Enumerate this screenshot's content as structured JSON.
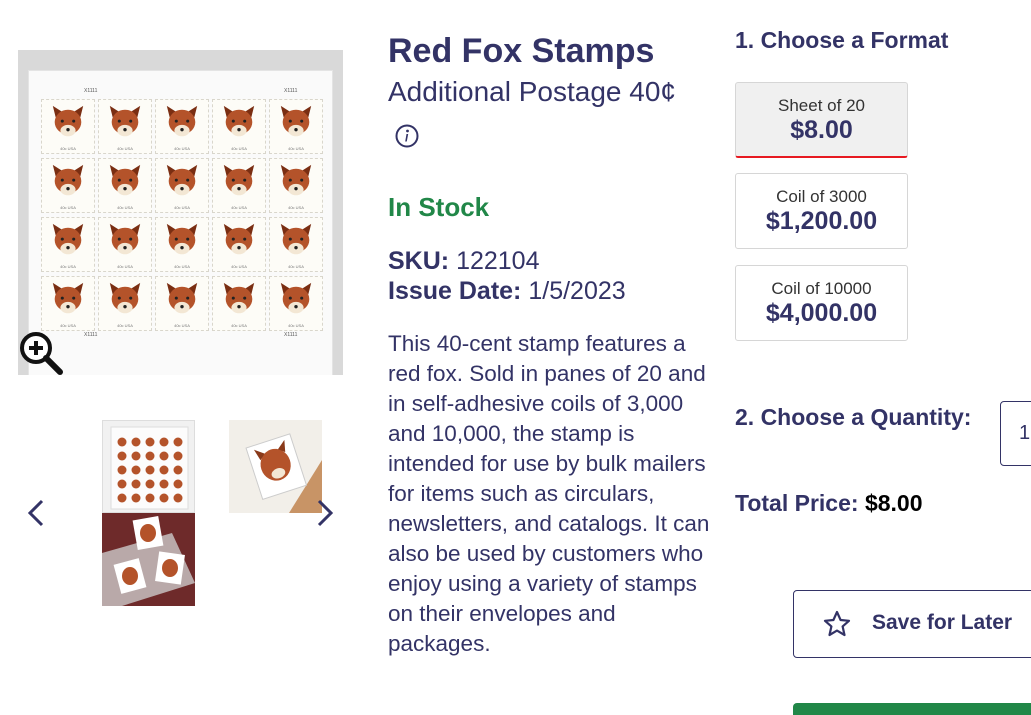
{
  "product": {
    "title": "Red Fox Stamps",
    "subtitle": "Additional Postage 40¢",
    "stock_status": "In Stock",
    "sku_label": "SKU:",
    "sku_value": "122104",
    "issue_label": "Issue Date:",
    "issue_value": "1/5/2023",
    "description": "This 40-cent stamp features a red fox. Sold in panes of 20 and in self-adhesive coils of 3,000 and 10,000, the stamp is intended for use by bulk mailers for items such as circulars, newsletters, and catalogs. It can also be used by customers who enjoy using a variety of stamps on their envelopes and packages."
  },
  "gallery": {
    "sheet_labels": [
      "X1111",
      "X1111",
      "X1111",
      "X1111"
    ],
    "stamp_denomination": "40c USA",
    "icons": {
      "zoom": "zoom-in-icon",
      "prev": "chevron-left-icon",
      "next": "chevron-right-icon",
      "info": "info-icon"
    }
  },
  "purchase": {
    "format_heading": "1. Choose a Format",
    "formats": [
      {
        "name": "Sheet of 20",
        "price": "$8.00",
        "selected": true
      },
      {
        "name": "Coil of 3000",
        "price": "$1,200.00",
        "selected": false
      },
      {
        "name": "Coil of 10000",
        "price": "$4,000.00",
        "selected": false
      }
    ],
    "quantity_heading": "2. Choose a Quantity:",
    "quantity_value": "1",
    "total_label": "Total Price:",
    "total_value": "$8.00",
    "save_label": "Save for Later",
    "save_icon": "star-outline-icon"
  },
  "colors": {
    "navy": "#333366",
    "green": "#218748",
    "red_accent": "#e71921"
  }
}
